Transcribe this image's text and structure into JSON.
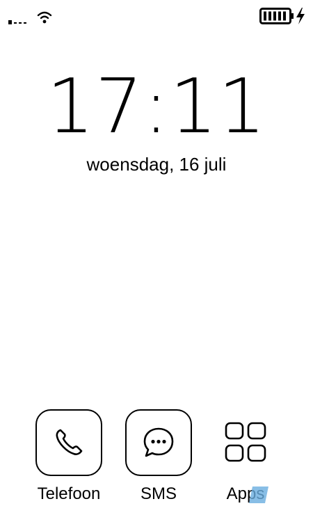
{
  "status_bar": {
    "signal_icon": "signal-weak-icon",
    "wifi_icon": "wifi-icon",
    "battery_icon": "battery-full-icon",
    "charging_icon": "charging-bolt-icon"
  },
  "lockscreen": {
    "time": "17:11",
    "date": "woensdag, 16 juli"
  },
  "dock": {
    "items": [
      {
        "label": "Telefoon",
        "icon": "phone-icon"
      },
      {
        "label": "SMS",
        "icon": "message-icon"
      },
      {
        "label": "Apps",
        "icon": "apps-grid-icon"
      }
    ]
  },
  "colors": {
    "foreground": "#000000",
    "background": "#ffffff",
    "cursor_accent": "#6aaee0"
  }
}
